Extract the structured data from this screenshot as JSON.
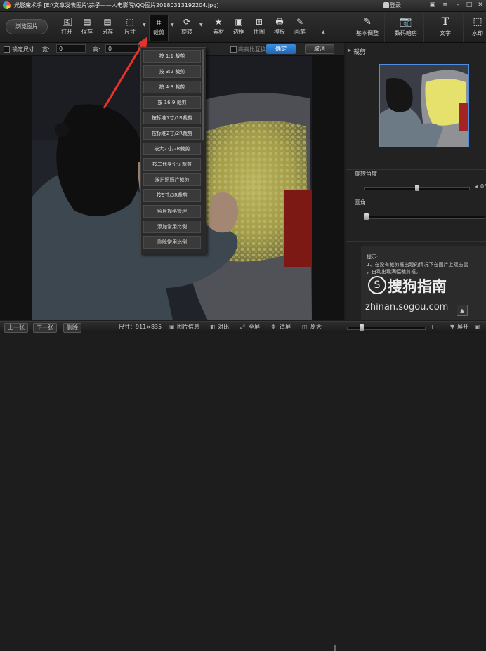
{
  "titlebar": {
    "title": "光影魔术手 [E:\\文章发表图片\\蒜子——人电影院\\QQ图片20180313192204.jpg]",
    "login": "登录"
  },
  "toolbar": {
    "browse": "浏览图片",
    "items": [
      "打开",
      "保存",
      "另存",
      "尺寸",
      "裁剪",
      "旋转",
      "素材",
      "边框",
      "拼图",
      "模板",
      "画笔"
    ],
    "right_items": [
      "基本调整",
      "数码暗房",
      "文字",
      "水印"
    ]
  },
  "optbar": {
    "lock_ratio": "锁定尺寸",
    "width_label": "宽:",
    "width_value": "0",
    "height_label": "高:",
    "height_value": "0",
    "highlight": "亮高比互换",
    "ok": "确定",
    "cancel": "取消"
  },
  "dropdown": {
    "items": [
      "按 1:1 裁剪",
      "按 3:2 裁剪",
      "按 4:3 裁剪",
      "按 16:9 裁剪",
      "按标准1寸/1R裁剪",
      "按标准2寸/2R裁剪",
      "按大2寸/2R裁剪",
      "按二代身份证裁剪",
      "按护照照片裁剪",
      "按5寸/3R裁剪",
      "照片规格管理",
      "添加常用比例",
      "删除常用比例"
    ]
  },
  "rpanel": {
    "header": "裁剪",
    "rotate_label": "旋转角度",
    "rotate_value": "0°",
    "corner_label": "圆角",
    "tip_title": "提示:",
    "tip_line1": "1、在没有裁剪框出现的情况下在图片上双击鼠",
    "tip_line2": "，自动出现满幅裁剪框。",
    "watermark": "搜狗指南",
    "watermark_url": "zhinan.sogou.com"
  },
  "statusbar": {
    "prev": "上一张",
    "next": "下一张",
    "delete": "删除",
    "size": "尺寸：911×835",
    "info": "图片信息",
    "compare": "对比",
    "fullscreen": "全屏",
    "fit": "适屏",
    "original": "原大",
    "expand": "展开"
  },
  "colors": {
    "accent": "#2a78d0",
    "arrow": "#e8332c",
    "popcorn": "#d9d36a"
  }
}
